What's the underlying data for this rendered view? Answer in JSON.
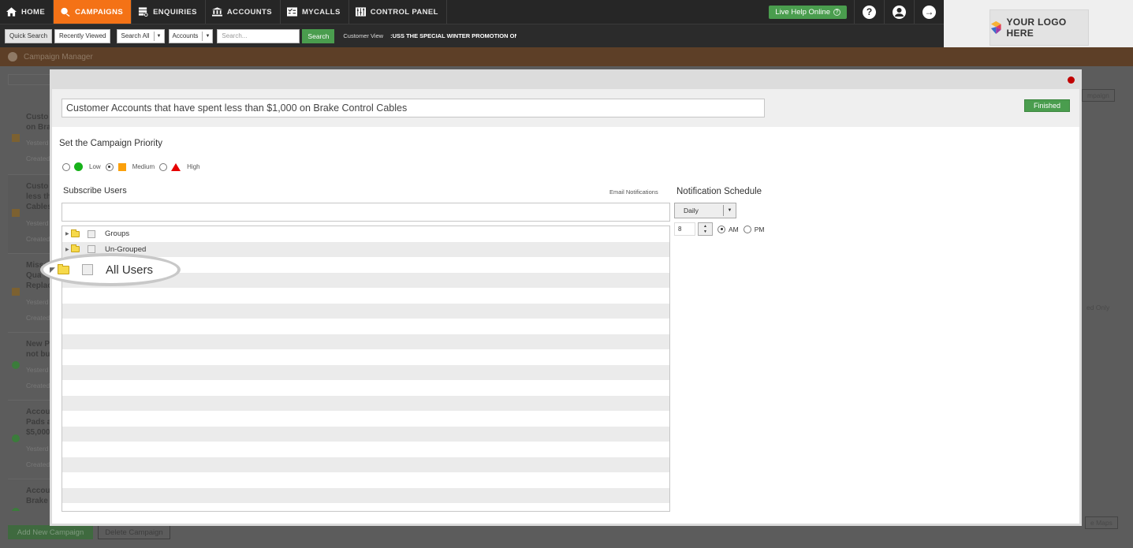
{
  "nav": {
    "items": [
      {
        "label": "HOME",
        "icon": "home-icon",
        "active": false
      },
      {
        "label": "CAMPAIGNS",
        "icon": "campaign-icon",
        "active": true
      },
      {
        "label": "ENQUIRIES",
        "icon": "enquiries-icon",
        "active": false
      },
      {
        "label": "ACCOUNTS",
        "icon": "bank-icon",
        "active": false
      },
      {
        "label": "MYCALLS",
        "icon": "calls-icon",
        "active": false
      },
      {
        "label": "CONTROL PANEL",
        "icon": "grid-icon",
        "active": false
      }
    ],
    "live_help": "Live Help Online",
    "help_glyph": "?",
    "user_glyph": "👤",
    "logout_glyph": "→"
  },
  "search": {
    "quick_search": "Quick Search",
    "recently_viewed": "Recently Viewed",
    "scope": "Search All",
    "type": "Accounts",
    "placeholder": "Search...",
    "go": "Search",
    "customer_view": "Customer View",
    "ticker": ":USS THE SPECIAL WINTER PROMOTION ON BA"
  },
  "logo": {
    "text": "YOUR LOGO HERE"
  },
  "header": {
    "title": "Campaign Manager"
  },
  "background": {
    "campaigns": [
      {
        "title": "Custo\non Bra",
        "meta1": "Yesterd",
        "meta2": "Created",
        "mark": "square"
      },
      {
        "title": "Custo\nless th\nCables",
        "meta1": "Yesterd",
        "meta2": "Created",
        "mark": "square"
      },
      {
        "title": "Misse\nQua\nReplac",
        "meta1": "Yesterd",
        "meta2": "Created",
        "mark": "square"
      },
      {
        "title": "New P\nnot buy",
        "meta1": "Yesterd",
        "meta2": "Created",
        "mark": "circle"
      },
      {
        "title": "Accou\nPads a\n$5,000",
        "meta1": "Yesterd",
        "meta2": "Created",
        "mark": "circle"
      },
      {
        "title": "Accou\nBrake",
        "meta1": "",
        "meta2": "",
        "mark": "circle"
      }
    ],
    "add_campaign": "Add New Campaign",
    "delete_campaign": "Delete Campaign",
    "right_btn": "mpaign",
    "right_text": "ed Only",
    "maps_btn": "e Maps"
  },
  "modal": {
    "campaign_name": "Customer Accounts that have spent less than $1,000 on Brake Control Cables",
    "finished": "Finished",
    "priority_title": "Set the Campaign Priority",
    "priorities": [
      {
        "label": "Low",
        "color": "#17b21a",
        "selected": false
      },
      {
        "label": "Medium",
        "color": "#fba00b",
        "selected": true
      },
      {
        "label": "High",
        "color": "#e60000",
        "selected": false
      }
    ],
    "subscribe_title": "Subscribe Users",
    "email_notifications": "Email Notifications",
    "tree": [
      {
        "label": "Groups"
      },
      {
        "label": "Un-Grouped"
      }
    ],
    "callout_label": "All Users",
    "notification_title": "Notification Schedule",
    "frequency": "Daily",
    "hour": "8",
    "am": "AM",
    "pm": "PM",
    "am_selected": true
  }
}
